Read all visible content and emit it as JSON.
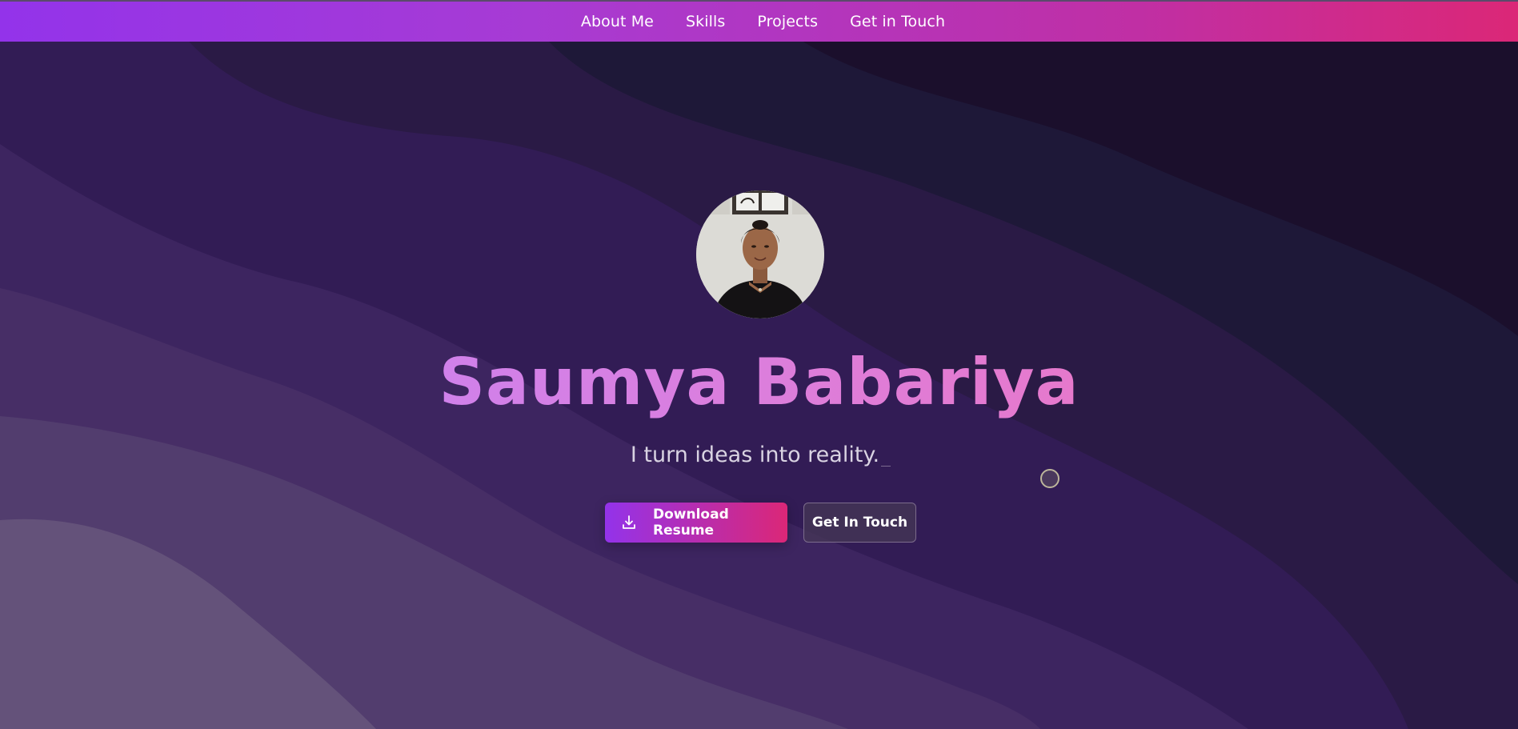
{
  "nav": {
    "links": [
      {
        "label": "About Me"
      },
      {
        "label": "Skills"
      },
      {
        "label": "Projects"
      },
      {
        "label": "Get in Touch"
      }
    ]
  },
  "hero": {
    "avatar_alt": "profile photo",
    "name": "Saumya Babariya",
    "tagline": "I turn ideas into reality.",
    "buttons": {
      "download_label": "Download Resume",
      "download_icon": "download-icon",
      "contact_label": "Get In Touch"
    }
  },
  "colors": {
    "nav_gradient_start": "#9333ea",
    "nav_gradient_end": "#db2777",
    "name_gradient_start": "#c084fc",
    "name_gradient_end": "#f472b6",
    "tagline": "#d9d3e2"
  }
}
